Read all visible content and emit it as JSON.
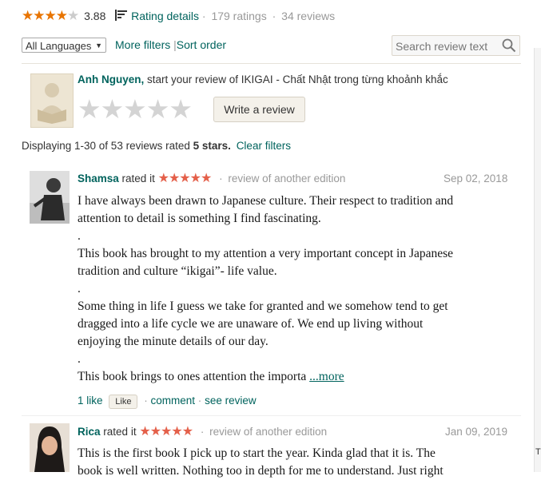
{
  "summary": {
    "avg": "3.88",
    "rating_details": "Rating details",
    "sep1": "·",
    "ratings": "179 ratings",
    "sep2": "·",
    "reviews": "34 reviews"
  },
  "filters": {
    "language": "All Languages",
    "more_filters": "More filters",
    "divider": "|",
    "sort_order": "Sort order",
    "search_placeholder": "Search review text"
  },
  "compose": {
    "user_name": "Anh Nguyen,",
    "prompt": "start your review of IKIGAI - Chất Nhật trong từng khoảnh khắc",
    "write_button": "Write a review"
  },
  "display": {
    "prefix": "Displaying 1-30 of 53 reviews rated",
    "stars_label": "5 stars.",
    "clear": "Clear filters"
  },
  "reviews": [
    {
      "name": "Shamsa",
      "rated_it": "rated it",
      "stars": "★★★★★",
      "edition": "review of another edition",
      "date": "Sep 02, 2018",
      "lines": [
        "I have always been drawn to Japanese culture. Their respect to tradition and",
        "attention to detail is something I find fascinating.",
        ".",
        "This book has brought to my attention a very important concept in Japanese",
        "tradition and culture “ikigai”- life value.",
        ".",
        "Some thing in life I guess we take for granted and we somehow tend to get",
        "dragged into a life cycle we are unaware of. We end up living without",
        "enjoying the minute details of our day.",
        ".",
        "This book brings to ones attention the importa"
      ],
      "more": "...more",
      "likes": "1 like",
      "like_button": "Like",
      "comment": "comment",
      "see_review": "see review",
      "dot": "·"
    },
    {
      "name": "Rica",
      "rated_it": "rated it",
      "stars": "★★★★★",
      "edition": "review of another edition",
      "date": "Jan 09, 2019",
      "lines": [
        "This is the first book I pick up to start the year. Kinda glad that it is. The",
        "book is well written. Nothing too in depth for me to understand. Just right"
      ]
    }
  ],
  "colors": {
    "teal": "#00635d",
    "star_orange": "#e87400",
    "star_red": "#e4604a",
    "grey_text": "#999999"
  }
}
